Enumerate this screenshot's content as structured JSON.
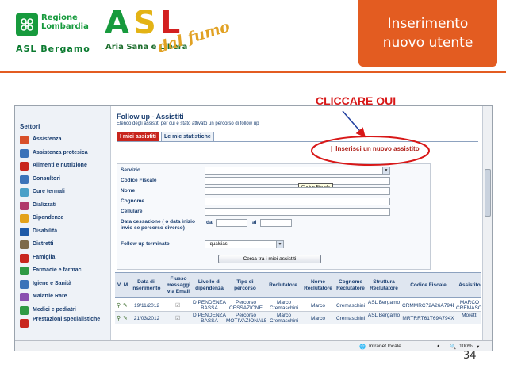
{
  "slide": {
    "title_line1": "Inserimento",
    "title_line2": "nuovo utente",
    "page_number": "34",
    "annotation": "CLICCARE QUI"
  },
  "logos": {
    "regione_line1": "Regione",
    "regione_line2": "Lombardia",
    "asl_bergamo": "ASL Bergamo",
    "asl_letters": [
      "A",
      "S",
      "L"
    ],
    "tagline": "Aria Sana e Libera",
    "dal_fumo": "dal fumo"
  },
  "sidebar": {
    "title": "Settori",
    "items": [
      {
        "label": "Assistenza",
        "icon": "hands-icon",
        "color": "#d8502a"
      },
      {
        "label": "Assistenza protesica",
        "icon": "crutch-icon",
        "color": "#3b73b9"
      },
      {
        "label": "Alimenti e nutrizione",
        "icon": "apple-icon",
        "color": "#c8261e"
      },
      {
        "label": "Consultori",
        "icon": "family-icon",
        "color": "#3b73b9"
      },
      {
        "label": "Cure termali",
        "icon": "spa-icon",
        "color": "#4aa0c8"
      },
      {
        "label": "Dializzati",
        "icon": "kidney-icon",
        "color": "#b03a6b"
      },
      {
        "label": "Dipendenze",
        "icon": "pill-icon",
        "color": "#e3a21a"
      },
      {
        "label": "Disabilità",
        "icon": "wheelchair-icon",
        "color": "#1e5aa8"
      },
      {
        "label": "Distretti",
        "icon": "building-icon",
        "color": "#7d6a4a"
      },
      {
        "label": "Famiglia",
        "icon": "family-icon",
        "color": "#c8261e"
      },
      {
        "label": "Farmacie e farmaci",
        "icon": "pharmacy-icon",
        "color": "#2f9a44"
      },
      {
        "label": "Igiene e Sanità",
        "icon": "hygiene-icon",
        "color": "#3b73b9"
      },
      {
        "label": "Malattie Rare",
        "icon": "dna-icon",
        "color": "#8a4fb0"
      },
      {
        "label": "Medici e pediatri",
        "icon": "doctor-icon",
        "color": "#2f9a44"
      },
      {
        "label": "Prestazioni specialistiche",
        "icon": "stethoscope-icon",
        "color": "#c8261e"
      }
    ]
  },
  "page": {
    "title": "Follow up - Assistiti",
    "subtitle": "Elenco degli assistiti per cui è stato attivato un percorso di follow up",
    "tabs": [
      "I miei assistiti",
      "Le mie statistiche"
    ],
    "insert_link": "Inserisci un nuovo assistito",
    "insert_pipe": "|"
  },
  "form": {
    "labels": {
      "servizio": "Servizio",
      "codice_fiscale": "Codice Fiscale",
      "nome": "Nome",
      "cognome": "Cognome",
      "cellulare": "Cellulare",
      "data_cessazione": "Data cessazione ( o data inizio invio se percorso diverso)",
      "follow_up_terminato": "Follow up terminato"
    },
    "dal": "dal",
    "al": "al",
    "follow_up_value": "- qualsiasi -",
    "tooltip": "Codice Fiscale",
    "search_button": "Cerca tra i miei assistiti"
  },
  "grid": {
    "columns": [
      "V",
      "M",
      "Data di Inserimento",
      "Flusso messaggi via Email",
      "Livello di dipendenza",
      "Tipo di percorso",
      "Reclutatore",
      "Nome Reclutatore",
      "Cognome Reclutatore",
      "Struttura Reclutatore",
      "Codice Fiscale",
      "Assistito"
    ],
    "rows": [
      {
        "date": "19/11/2012",
        "livello": "DIPENDENZA BASSA",
        "tipo": "Percorso CESSAZIONE",
        "reclutatore": "Marco Cremaschini",
        "nome": "Marco",
        "cognome": "Cremaschini",
        "struttura": "ASL Bergamo",
        "codice": "CRMMRC72A26A794E",
        "assistito": "MARCO CREMASCHI"
      },
      {
        "date": "21/03/2012",
        "livello": "DIPENDENZA BASSA",
        "tipo": "Percorso MOTIVAZIONALE",
        "reclutatore": "Marco Cremaschini",
        "nome": "Marco",
        "cognome": "Cremaschini",
        "struttura": "ASL Bergamo",
        "codice": "MRTRRT61T69A794X",
        "assistito": "Moretti"
      }
    ]
  },
  "browser": {
    "zone": "Intranet locale",
    "zoom": "100%"
  }
}
